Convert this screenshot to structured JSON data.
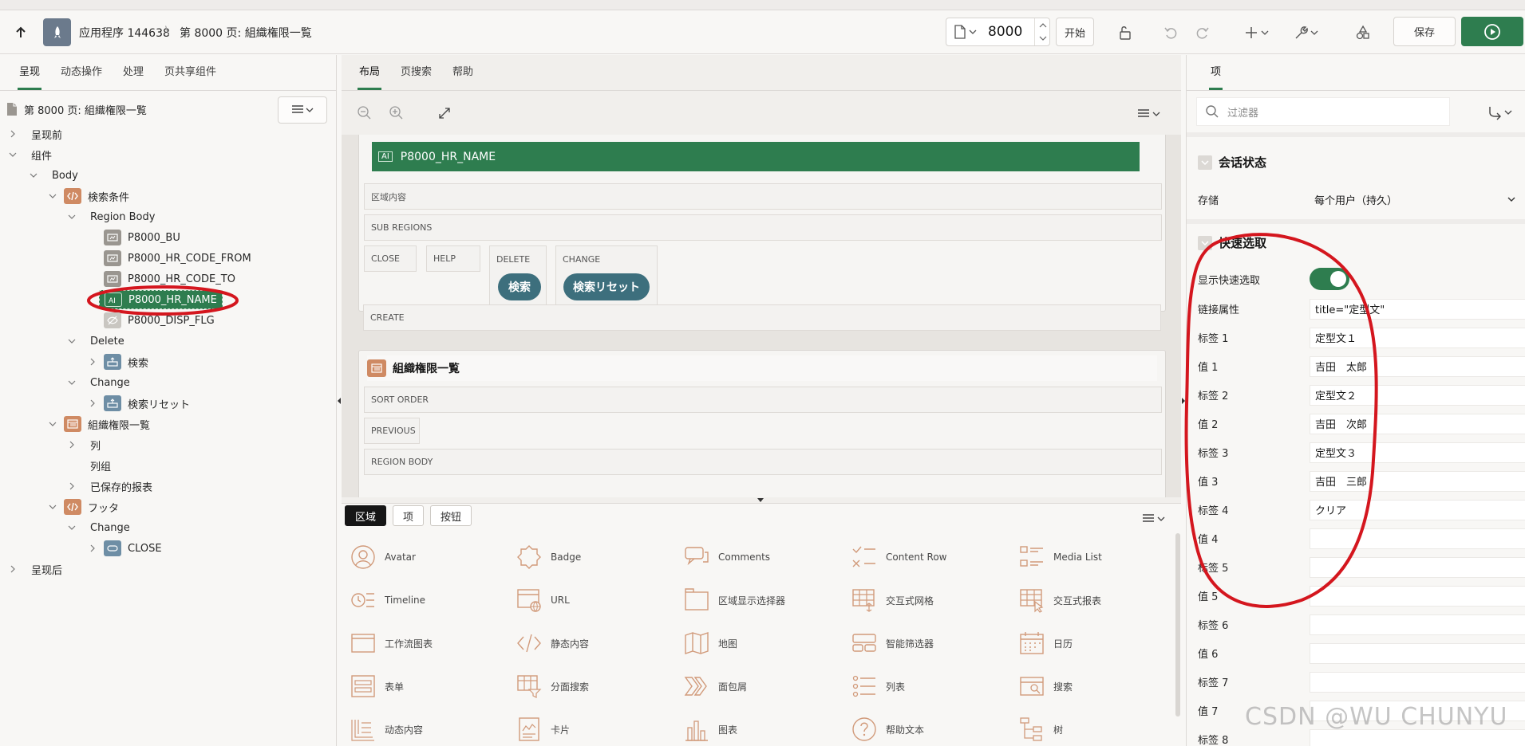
{
  "header": {
    "app_name": "应用程序 144638",
    "separator": "\\",
    "page_name": "第 8000 页: 組織権限一覧",
    "page_number": "8000",
    "start_label": "开始",
    "save_label": "保存"
  },
  "left": {
    "tabs": [
      "呈现",
      "动态操作",
      "处理",
      "页共享组件"
    ],
    "page_title": "第 8000 页: 組織権限一覧",
    "tree": {
      "before": "呈现前",
      "components": "组件",
      "body": "Body",
      "search_region": "検索条件",
      "region_body": "Region Body",
      "items": [
        "P8000_BU",
        "P8000_HR_CODE_FROM",
        "P8000_HR_CODE_TO",
        "P8000_HR_NAME",
        "P8000_DISP_FLG"
      ],
      "delete": "Delete",
      "search_btn": "検索",
      "change": "Change",
      "reset_btn": "検索リセット",
      "report_region": "組織権限一覧",
      "columns": "列",
      "col_groups": "列组",
      "saved_reports": "已保存的报表",
      "footer": "フッタ",
      "footer_change": "Change",
      "close": "CLOSE",
      "after": "呈现后"
    }
  },
  "middle": {
    "tabs": [
      "布局",
      "页搜索",
      "帮助"
    ],
    "canvas": {
      "selected_item": "P8000_HR_NAME",
      "region_content": "区域内容",
      "sub_regions": "SUB REGIONS",
      "slots": [
        "CLOSE",
        "HELP",
        "DELETE",
        "CHANGE"
      ],
      "search_pill": "検索",
      "reset_pill": "検索リセット",
      "create": "CREATE",
      "report_title": "組織権限一覧",
      "sort_order": "SORT ORDER",
      "previous": "PREVIOUS",
      "region_body": "REGION BODY"
    },
    "gallery_tabs": [
      "区域",
      "项",
      "按钮"
    ],
    "gallery": [
      [
        "Avatar",
        "Badge",
        "Comments",
        "Content Row",
        "Media List"
      ],
      [
        "Timeline",
        "URL",
        "区域显示选择器",
        "交互式网格",
        "交互式报表"
      ],
      [
        "工作流图表",
        "静态内容",
        "地图",
        "智能筛选器",
        "日历"
      ],
      [
        "表单",
        "分面搜索",
        "面包屑",
        "列表",
        "搜索"
      ],
      [
        "动态内容",
        "卡片",
        "图表",
        "帮助文本",
        "树"
      ]
    ]
  },
  "right": {
    "tab": "项",
    "filter_placeholder": "过滤器",
    "session_section": "会话状态",
    "storage_label": "存储",
    "storage_value": "每个用户（持久）",
    "quick_section": "快速选取",
    "rows": [
      {
        "label": "显示快速选取",
        "value": ""
      },
      {
        "label": "链接属性",
        "value": "title=\"定型文\""
      },
      {
        "label": "标签 1",
        "value": "定型文１"
      },
      {
        "label": "值 1",
        "value": "吉田　太郎"
      },
      {
        "label": "标签 2",
        "value": "定型文２"
      },
      {
        "label": "值 2",
        "value": "吉田　次郎"
      },
      {
        "label": "标签 3",
        "value": "定型文３"
      },
      {
        "label": "值 3",
        "value": "吉田　三郎"
      },
      {
        "label": "标签 4",
        "value": "クリア"
      },
      {
        "label": "值 4",
        "value": ""
      },
      {
        "label": "标签 5",
        "value": ""
      },
      {
        "label": "值 5",
        "value": ""
      },
      {
        "label": "标签 6",
        "value": ""
      },
      {
        "label": "值 6",
        "value": ""
      },
      {
        "label": "标签 7",
        "value": ""
      },
      {
        "label": "值 7",
        "value": ""
      },
      {
        "label": "标签 8",
        "value": ""
      }
    ]
  },
  "watermark": "CSDN @WU CHUNYU",
  "colors": {
    "accent": "#2e7d4f",
    "annotation": "#d4161e",
    "region_icon": "#cf8a63",
    "button_pill": "#3d6f7d"
  }
}
